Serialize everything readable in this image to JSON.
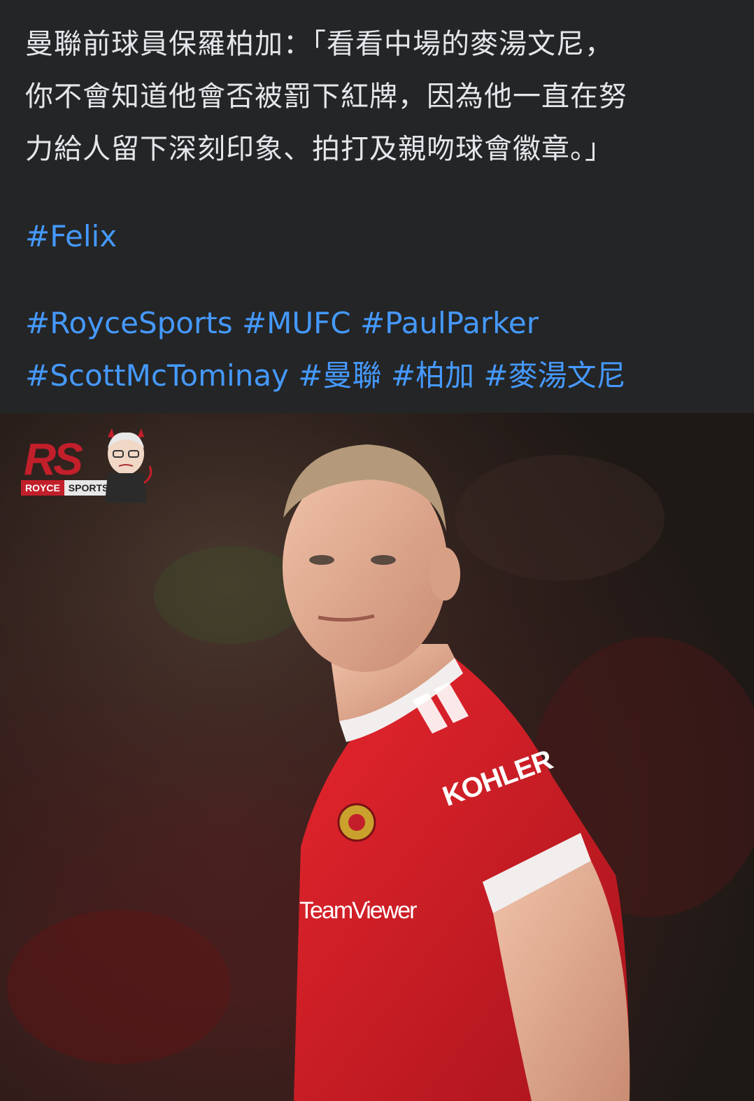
{
  "post": {
    "quote_lines": [
      "曼聯前球員保羅柏加：「看看中場的麥湯文尼，",
      "你不會知道他會否被罰下紅牌，因為他一直在努",
      "力給人留下深刻印象、拍打及親吻球會徽章。」"
    ],
    "hashtag_felix": "#Felix",
    "hashtags_row1": [
      "#RoyceSports",
      "#MUFC",
      "#PaulParker"
    ],
    "hashtags_row2": [
      "#ScottMcTominay",
      "#曼聯",
      "#柏加",
      "#麥湯文尼"
    ]
  },
  "photo": {
    "watermark": {
      "logo_letters": "RS",
      "brand_left": "ROYCE",
      "brand_right": "SPORTS"
    },
    "shirt_sponsor": "KOHLER",
    "sleeve_sponsor": "TeamViewer"
  },
  "colors": {
    "background": "#242526",
    "text": "#e4e6eb",
    "hashtag": "#4599ff",
    "brand_red": "#c21f2b"
  }
}
